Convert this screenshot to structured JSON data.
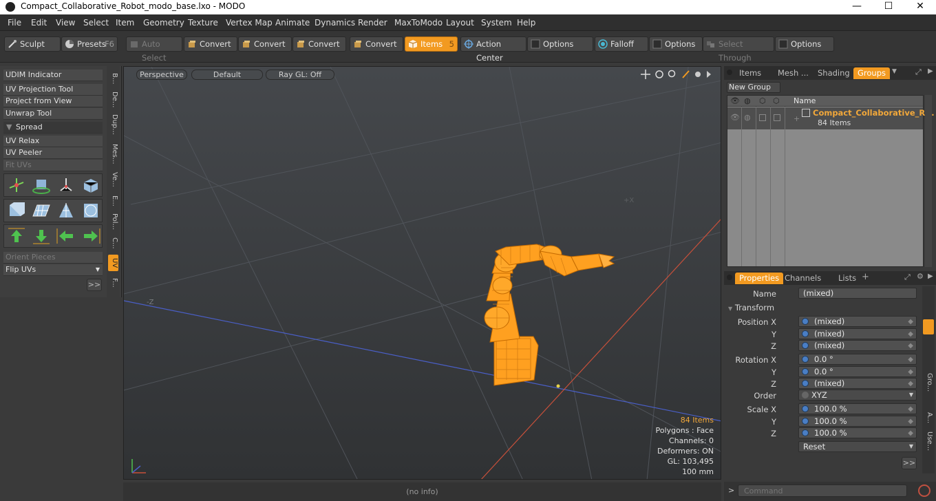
{
  "window": {
    "title": "Compact_Collaborative_Robot_modo_base.lxo - MODO",
    "minimize": "—",
    "maximize": "☐",
    "close": "✕"
  },
  "menu": [
    "File",
    "Edit",
    "View",
    "Select",
    "Item",
    "Geometry",
    "Texture",
    "Vertex Map",
    "Animate",
    "Dynamics",
    "Render",
    "MaxToModo",
    "Layout",
    "System",
    "Help"
  ],
  "toolbar": {
    "sculpt": "Sculpt",
    "presets": "Presets",
    "presets_key": "F6",
    "auto_select": "Auto Select",
    "convert1": "Convert",
    "convert2": "Convert",
    "convert3": "Convert",
    "convert4": "Convert",
    "items": "Items",
    "items_key": "5",
    "action_center": "Action Center",
    "options1": "Options",
    "falloff": "Falloff",
    "options2": "Options",
    "select_through": "Select Through",
    "options3": "Options"
  },
  "left_panel": {
    "udim": "UDIM Indicator",
    "uv_projection": "UV Projection Tool",
    "project_view": "Project from View",
    "unwrap": "Unwrap Tool",
    "spread": "Spread",
    "uv_relax": "UV Relax",
    "uv_peeler": "UV Peeler",
    "fit_uvs": "Fit UVs",
    "orient": "Orient Pieces",
    "flip": "Flip UVs",
    "more": ">>"
  },
  "vtabs": [
    "B...",
    "De...",
    "Dup...",
    "Mes...",
    "Ve...",
    "E...",
    "Pol...",
    "C...",
    "UV",
    "F..."
  ],
  "viewport": {
    "perspective": "Perspective",
    "default": "Default",
    "raygl": "Ray GL: Off",
    "z_label": "-Z",
    "x_label": "+X",
    "stats": {
      "items": "84 Items",
      "polygons": "Polygons : Face",
      "channels": "Channels: 0",
      "deformers": "Deformers: ON",
      "gl": "GL: 103,495",
      "scale": "100 mm"
    }
  },
  "status": "(no info)",
  "groups_panel": {
    "tabs": [
      "Items",
      "Mesh ...",
      "Shading",
      "Groups"
    ],
    "new_group": "New Group",
    "name_header": "Name",
    "group_name": "Compact_Collaborative_R...",
    "group_count": "84 Items"
  },
  "properties": {
    "tabs": [
      "Properties",
      "Channels",
      "Lists"
    ],
    "name_label": "Name",
    "name_value": "(mixed)",
    "transform": "Transform",
    "pos_label": "Position X",
    "rot_label": "Rotation X",
    "order_label": "Order",
    "scale_label": "Scale X",
    "y": "Y",
    "z": "Z",
    "pos": [
      "(mixed)",
      "(mixed)",
      "(mixed)"
    ],
    "rot": [
      "0.0 °",
      "0.0 °",
      "(mixed)"
    ],
    "order": "XYZ",
    "scale": [
      "100.0 %",
      "100.0 %",
      "100.0 %"
    ],
    "reset": "Reset",
    "more": ">>",
    "side_tabs": [
      "Gro...",
      "A...",
      "Use..."
    ]
  },
  "command": {
    "prompt": ">",
    "placeholder": "Command"
  },
  "colors": {
    "accent": "#f29a21",
    "robot": "#ffa020",
    "axis_x": "#c8503a",
    "axis_z": "#4a5fc8"
  }
}
